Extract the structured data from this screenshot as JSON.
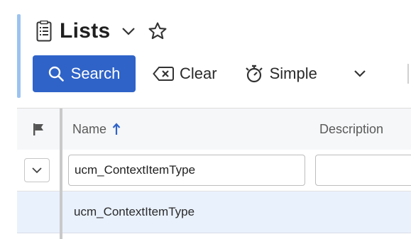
{
  "header": {
    "title": "Lists",
    "list_icon": "list-document-icon",
    "chevron_icon": "chevron-down-icon",
    "favorite_icon": "star-outline-icon"
  },
  "toolbar": {
    "search_label": "Search",
    "clear_label": "Clear",
    "simple_label": "Simple",
    "colors": {
      "primary": "#2f63c8"
    }
  },
  "grid": {
    "columns": [
      {
        "label": "Name",
        "sort": "ascending"
      },
      {
        "label": "Description"
      }
    ],
    "filters": {
      "name_value": "ucm_ContextItemType",
      "description_value": ""
    },
    "rows": [
      {
        "name": "ucm_ContextItemType"
      }
    ],
    "colors": {
      "selected_row": "#e9f1fd",
      "sort_arrow": "#2f63c8"
    }
  }
}
